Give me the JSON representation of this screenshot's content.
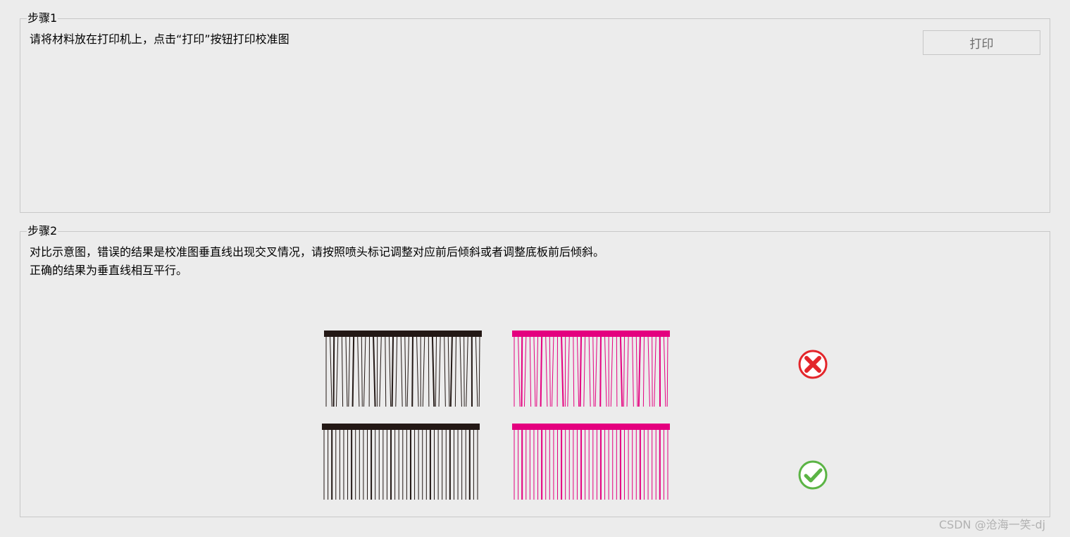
{
  "step1": {
    "title": "步骤1",
    "instruction": "请将材料放在打印机上，点击“打印”按钮打印校准图",
    "print_button_label": "打印"
  },
  "step2": {
    "title": "步骤2",
    "instruction_line1": "对比示意图，错误的结果是校准图垂直线出现交叉情况，请按照喷头标记调整对应前后倾斜或者调整底板前后倾斜。",
    "instruction_line2": "正确的结果为垂直线相互平行。",
    "examples": [
      {
        "result": "wrong",
        "icon": "cross-icon"
      },
      {
        "result": "correct",
        "icon": "check-icon"
      }
    ]
  },
  "colors": {
    "black_ink": "#231815",
    "magenta_ink": "#e4007f",
    "wrong_red": "#e3262b",
    "correct_green": "#5bb445"
  },
  "watermark": "CSDN @沧海一笑-dj"
}
